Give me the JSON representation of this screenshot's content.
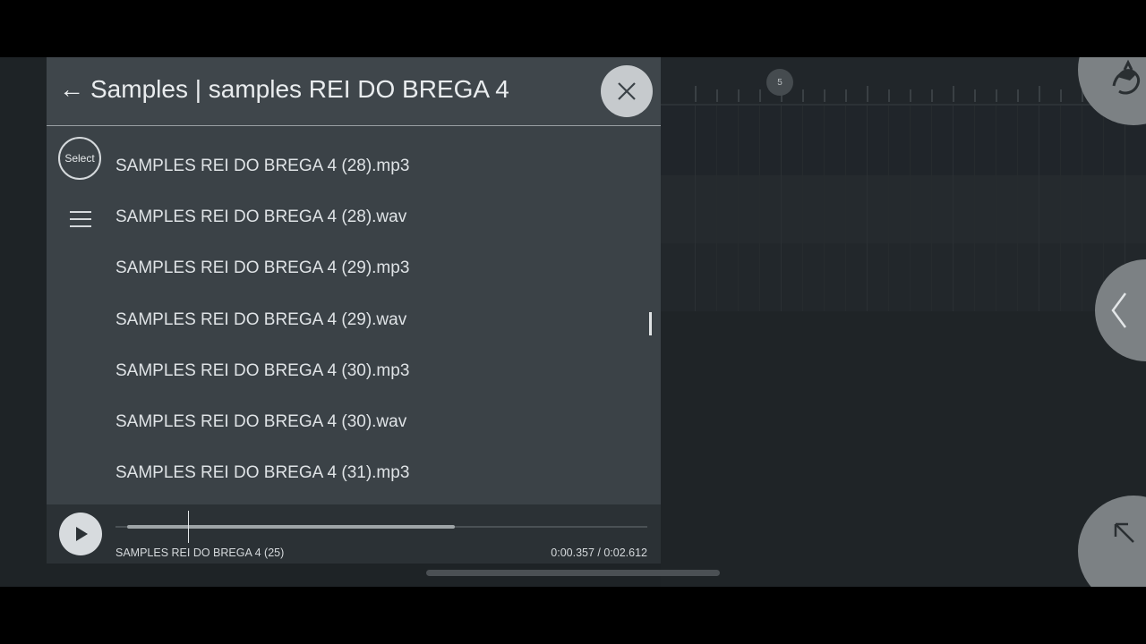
{
  "browser": {
    "back_icon": "back-arrow-icon",
    "title": "Samples | samples REI DO BREGA 4",
    "close_icon": "close-icon",
    "select_label": "Select",
    "menu_icon": "hamburger-menu-icon",
    "files": [
      "SAMPLES REI DO BREGA 4 (28).mp3",
      "SAMPLES REI DO BREGA 4 (28).wav",
      "SAMPLES REI DO BREGA 4 (29).mp3",
      "SAMPLES REI DO BREGA 4 (29).wav",
      "SAMPLES REI DO BREGA 4 (30).mp3",
      "SAMPLES REI DO BREGA 4 (30).wav",
      "SAMPLES REI DO BREGA 4 (31).mp3"
    ]
  },
  "player": {
    "play_icon": "play-icon",
    "now_playing": "SAMPLES REI DO BREGA 4 (25)",
    "time": "0:00.357 / 0:02.612",
    "buffered_fraction": 0.63,
    "position_fraction": 0.137
  },
  "playlist": {
    "bar_marker": "5"
  },
  "overlay_buttons": {
    "logo_icon": "fl-studio-logo-icon",
    "left_icon": "chevron-left-icon",
    "expand_icon": "expand-arrow-icon"
  },
  "colors": {
    "panel": "#3b4247",
    "header": "#3f464b",
    "player_bar": "#2b3135",
    "text": "#dfe3e6",
    "overlay_button": "#7c8184"
  }
}
